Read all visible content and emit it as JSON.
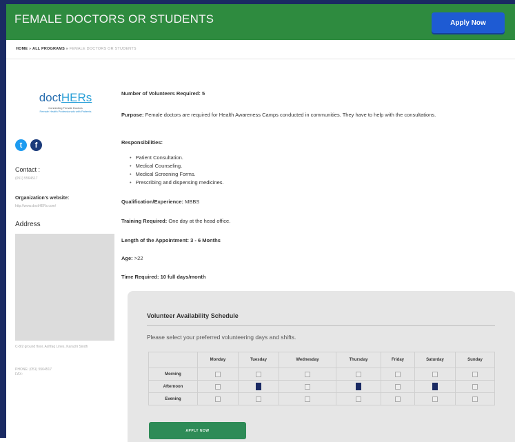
{
  "header": {
    "title": "FEMALE DOCTORS OR STUDENTS",
    "apply_label": "Apply Now"
  },
  "breadcrumb": {
    "home": "HOME",
    "programs": "ALL PROGRAMS",
    "current": "FEMALE DOCTORS OR STUDENTS"
  },
  "sidebar": {
    "logo_main": "doct",
    "logo_her": "HERs",
    "logo_tagline": "Connecting Female Doctors",
    "logo_tagline2": "Female Health Professionals with Patients",
    "contact_label": "Contact :",
    "contact_value": "(051) 5564517",
    "website_label": "Organization's website:",
    "website_value": "http://www.doctHERs.com/",
    "address_label": "Address",
    "address_text": "C-8/2 ground floor, Ashfaq Lines, Karachi Sindh",
    "phone_text": "PHONE: (051) 5564517",
    "fax_text": "FAX:"
  },
  "details": {
    "volunteers_label": "Number of Volunteers Required:",
    "volunteers_value": "5",
    "purpose_label": "Purpose:",
    "purpose_value": "Female doctors are required for Health Awareness Camps conducted in communities. They have to help with the consultations.",
    "responsibilities_label": "Responsibilities:",
    "responsibilities": [
      "Patient Consultation.",
      "Medical Counseling.",
      "Medical Screening Forms.",
      "Prescribing and dispensing medicines."
    ],
    "qualification_label": "Qualification/Experience:",
    "qualification_value": "MBBS",
    "training_label": "Training Required:",
    "training_value": "One day at the head office.",
    "length_label": "Length of the Appointment:",
    "length_value": "3 - 6 Months",
    "age_label": "Age:",
    "age_value": ">22",
    "time_label": "Time Required:",
    "time_value": "10 full days/month"
  },
  "schedule": {
    "title": "Volunteer Availability Schedule",
    "description": "Please select your preferred volunteering days and shifts.",
    "days": [
      "Monday",
      "Tuesday",
      "Wednesday",
      "Thursday",
      "Friday",
      "Saturday",
      "Sunday"
    ],
    "shifts": [
      {
        "name": "Morning",
        "checked": [
          false,
          false,
          false,
          false,
          false,
          false,
          false
        ]
      },
      {
        "name": "Afternoon",
        "checked": [
          false,
          true,
          false,
          true,
          false,
          true,
          false
        ]
      },
      {
        "name": "Evening",
        "checked": [
          false,
          false,
          false,
          false,
          false,
          false,
          false
        ]
      }
    ],
    "apply_label": "APPLY NOW"
  },
  "colors": {
    "header_green": "#2e8b3f",
    "apply_blue": "#1e5bd3",
    "frame_navy": "#1a2a63",
    "button_green": "#2e8b57"
  }
}
